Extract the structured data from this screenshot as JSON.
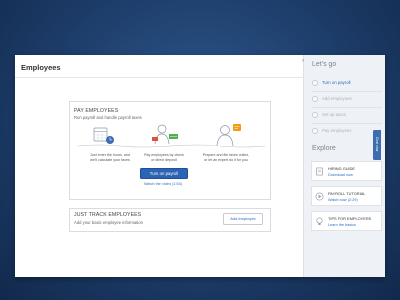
{
  "page": {
    "title": "Employees"
  },
  "pay_employees": {
    "heading": "PAY EMPLOYEES",
    "subheading": "Run payroll and handle payroll taxes",
    "steps": [
      {
        "line1": "Just enter the hours, and",
        "line2": "we'll calculate your taxes"
      },
      {
        "line1": "Pay employees by check",
        "line2": "or direct deposit"
      },
      {
        "line1": "Prepare and file taxes online,",
        "line2": "or let an expert do it for you"
      }
    ],
    "button_label": "Turn on payroll",
    "video_link": "Watch the video (1:54)"
  },
  "track_employees": {
    "heading": "JUST TRACK EMPLOYEES",
    "subheading": "Add your basic employee information",
    "button_label": "Add employee"
  },
  "sidebar": {
    "collapse_icon": "chevron-right",
    "lets_go_title": "Let's go",
    "todo_items": [
      {
        "label": "Turn on payroll",
        "enabled": true
      },
      {
        "label": "Add employees",
        "enabled": false
      },
      {
        "label": "Set up taxes",
        "enabled": false
      },
      {
        "label": "Pay employees",
        "enabled": false
      }
    ],
    "explore_title": "Explore",
    "explore_items": [
      {
        "title": "HIRING GUIDE",
        "link": "Download now",
        "icon": "book-icon"
      },
      {
        "title": "PAYROLL TUTORIAL",
        "link": "Watch now (2:29)",
        "icon": "play-icon"
      },
      {
        "title": "TIPS FOR EMPLOYERS",
        "link": "Learn the basics",
        "icon": "lightbulb-icon"
      }
    ]
  },
  "chat_tab": {
    "label": "Chat now"
  },
  "colors": {
    "primary": "#2b63b5",
    "link": "#2a6dc4",
    "background": "#1d3d6a"
  }
}
